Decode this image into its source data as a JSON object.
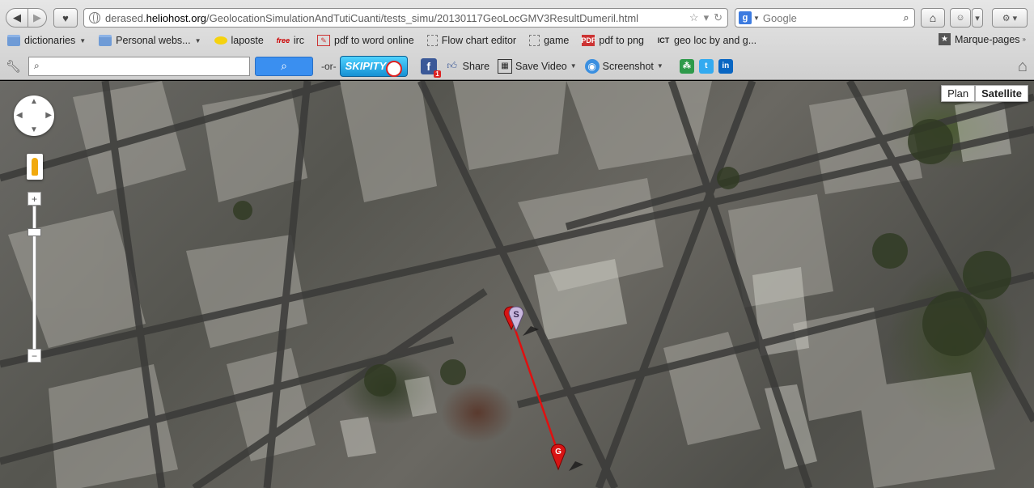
{
  "browser": {
    "url_prefix": "derased.",
    "url_domain": "heliohost.org",
    "url_path": "/GeolocationSimulationAndTutiCuanti/tests_simu/20130117GeoLocGMV3ResultDumeril.html",
    "search_placeholder": "Google"
  },
  "bookmarks": [
    {
      "label": "dictionaries",
      "icon": "folder-icon",
      "dropdown": true
    },
    {
      "label": "Personal webs...",
      "icon": "folder-icon",
      "dropdown": true
    },
    {
      "label": "laposte",
      "icon": "laposte-icon"
    },
    {
      "label": "irc",
      "icon": "free-icon"
    },
    {
      "label": "pdf to word online",
      "icon": "pdf-icon"
    },
    {
      "label": "Flow chart editor",
      "icon": "page-icon"
    },
    {
      "label": "game",
      "icon": "page-icon"
    },
    {
      "label": "pdf to png",
      "icon": "pdf-icon"
    },
    {
      "label": "geo loc by and g...",
      "icon": "ict-icon"
    }
  ],
  "bookmarks_right": {
    "label": "Marque-pages"
  },
  "toolbar2": {
    "or_label": "-or-",
    "skipity_label": "SKIPITY",
    "fb_badge": "1",
    "share_label": "Share",
    "save_video_label": "Save Video",
    "screenshot_label": "Screenshot"
  },
  "map": {
    "type_plan": "Plan",
    "type_satellite": "Satellite",
    "selected_type": "Satellite",
    "start_marker": "S",
    "goal_marker": "G",
    "route_color": "#e01010"
  }
}
